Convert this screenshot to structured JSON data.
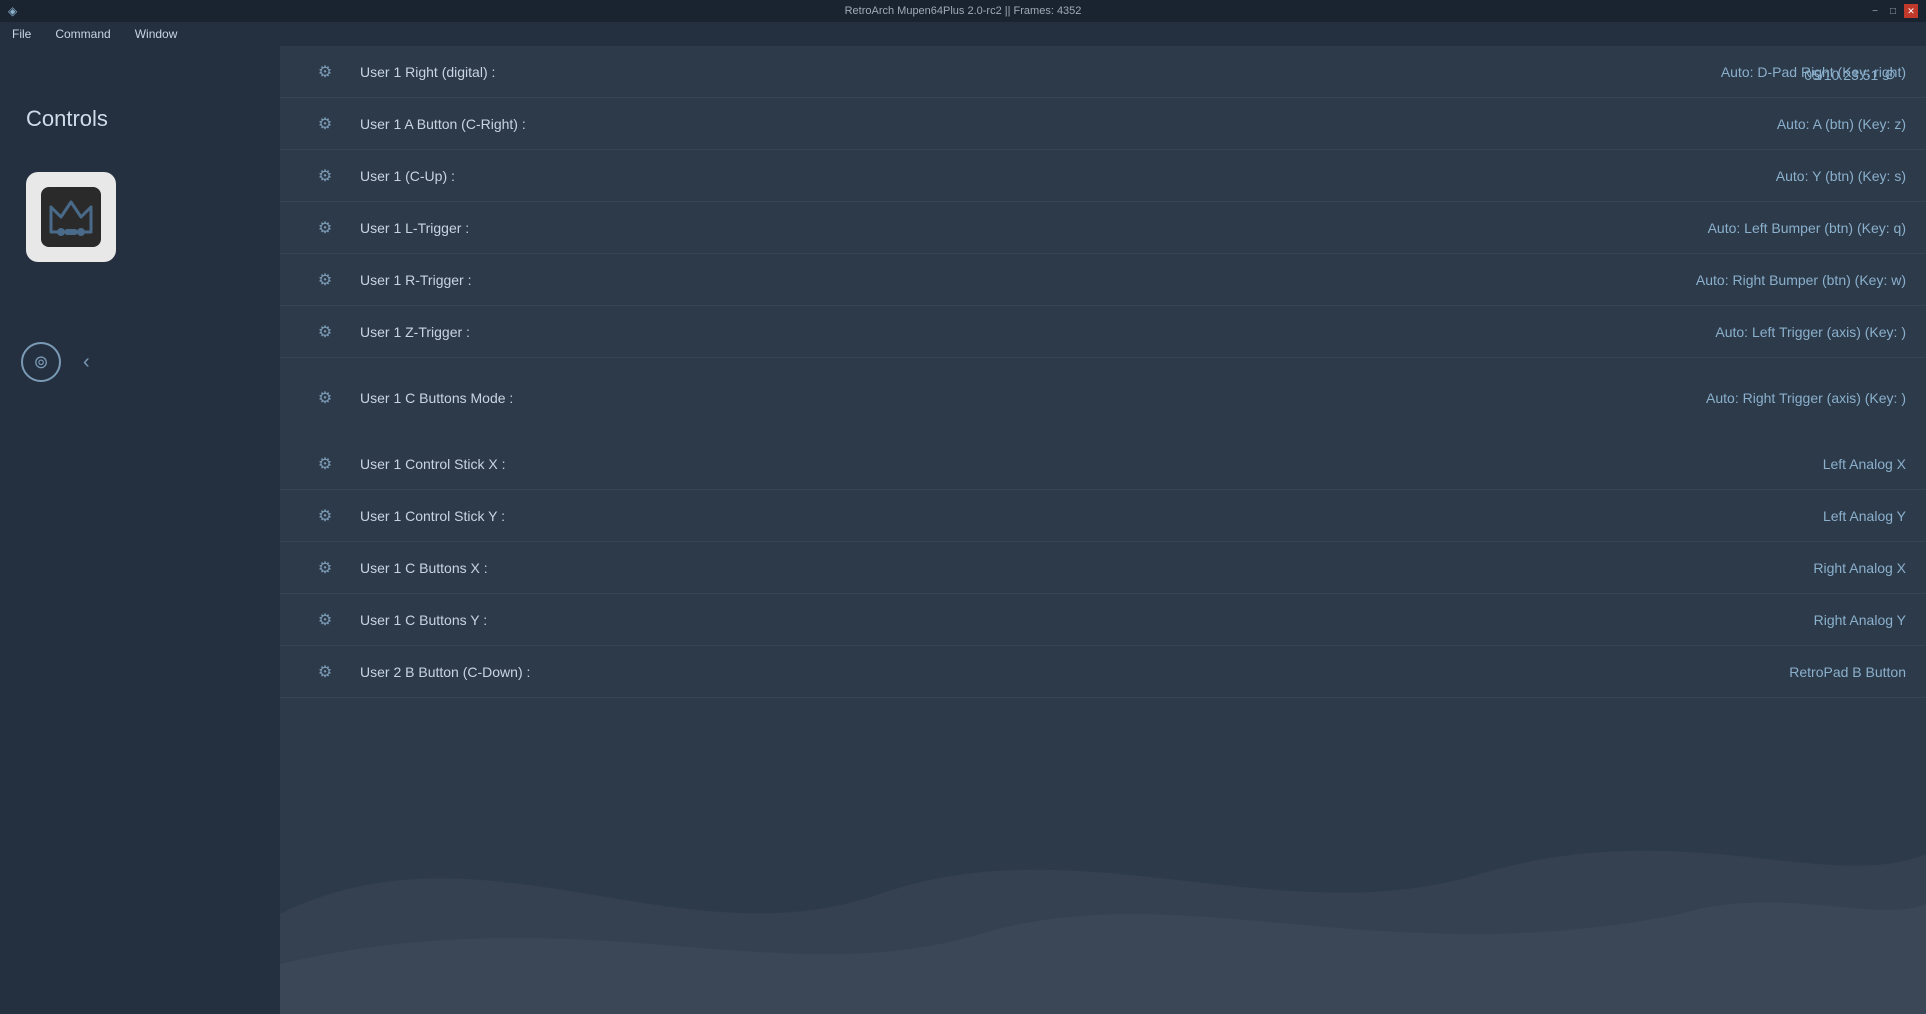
{
  "titleBar": {
    "title": "RetroArch Mupen64Plus 2.0-rc2 || Frames: 4352",
    "icon": "◈"
  },
  "menuBar": {
    "items": [
      "File",
      "Command",
      "Window"
    ]
  },
  "sidebar": {
    "title": "Controls"
  },
  "timestamp": "05/10 23:51",
  "rows": [
    {
      "label": "User 1 Right (digital) :",
      "value": "Auto: D-Pad Right (Key: right)"
    },
    {
      "label": "User 1 A Button (C-Right) :",
      "value": "Auto: A (btn) (Key: z)"
    },
    {
      "label": "User 1 (C-Up) :",
      "value": "Auto: Y (btn) (Key: s)"
    },
    {
      "label": "User 1 L-Trigger :",
      "value": "Auto: Left Bumper (btn) (Key: q)"
    },
    {
      "label": "User 1 R-Trigger :",
      "value": "Auto: Right Bumper (btn) (Key: w)"
    },
    {
      "label": "User 1 Z-Trigger :",
      "value": "Auto: Left Trigger (axis) (Key: )"
    }
  ],
  "modeRow": {
    "label": "User 1 C Buttons Mode :",
    "value": "Auto: Right Trigger (axis) (Key: )"
  },
  "analogRows": [
    {
      "label": "User 1 Control Stick X :",
      "value": "Left Analog X"
    },
    {
      "label": "User 1 Control Stick Y :",
      "value": "Left Analog Y"
    },
    {
      "label": "User 1 C Buttons X :",
      "value": "Right Analog X"
    },
    {
      "label": "User 1 C Buttons Y :",
      "value": "Right Analog Y"
    },
    {
      "label": "User 2 B Button (C-Down) :",
      "value": "RetroPad B Button"
    }
  ],
  "icons": {
    "gear": "⚙",
    "back": "‹",
    "clock": "⊙",
    "controls": "⊚"
  }
}
